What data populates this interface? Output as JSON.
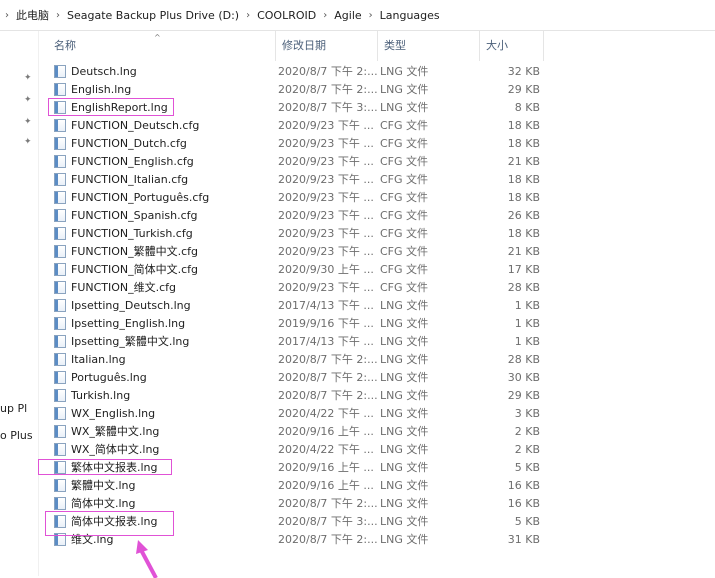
{
  "breadcrumb": {
    "items": [
      "此电脑",
      "Seagate Backup Plus Drive (D:)",
      "COOLROID",
      "Agile",
      "Languages"
    ]
  },
  "nav": {
    "partial_labels": [
      "up Pl",
      "o Plus"
    ]
  },
  "columns": {
    "name": "名称",
    "date": "修改日期",
    "type": "类型",
    "size": "大小"
  },
  "files": [
    {
      "name": "Deutsch.lng",
      "date": "2020/8/7 下午 2:...",
      "type": "LNG 文件",
      "size": "32 KB"
    },
    {
      "name": "English.lng",
      "date": "2020/8/7 下午 2:...",
      "type": "LNG 文件",
      "size": "29 KB"
    },
    {
      "name": "EnglishReport.lng",
      "date": "2020/8/7 下午 3:...",
      "type": "LNG 文件",
      "size": "8 KB"
    },
    {
      "name": "FUNCTION_Deutsch.cfg",
      "date": "2020/9/23 下午 ...",
      "type": "CFG 文件",
      "size": "18 KB"
    },
    {
      "name": "FUNCTION_Dutch.cfg",
      "date": "2020/9/23 下午 ...",
      "type": "CFG 文件",
      "size": "18 KB"
    },
    {
      "name": "FUNCTION_English.cfg",
      "date": "2020/9/23 下午 ...",
      "type": "CFG 文件",
      "size": "21 KB"
    },
    {
      "name": "FUNCTION_Italian.cfg",
      "date": "2020/9/23 下午 ...",
      "type": "CFG 文件",
      "size": "18 KB"
    },
    {
      "name": "FUNCTION_Português.cfg",
      "date": "2020/9/23 下午 ...",
      "type": "CFG 文件",
      "size": "18 KB"
    },
    {
      "name": "FUNCTION_Spanish.cfg",
      "date": "2020/9/23 下午 ...",
      "type": "CFG 文件",
      "size": "26 KB"
    },
    {
      "name": "FUNCTION_Turkish.cfg",
      "date": "2020/9/23 下午 ...",
      "type": "CFG 文件",
      "size": "18 KB"
    },
    {
      "name": "FUNCTION_繁體中文.cfg",
      "date": "2020/9/23 下午 ...",
      "type": "CFG 文件",
      "size": "21 KB"
    },
    {
      "name": "FUNCTION_简体中文.cfg",
      "date": "2020/9/30 上午 ...",
      "type": "CFG 文件",
      "size": "17 KB"
    },
    {
      "name": "FUNCTION_维文.cfg",
      "date": "2020/9/23 下午 ...",
      "type": "CFG 文件",
      "size": "28 KB"
    },
    {
      "name": "Ipsetting_Deutsch.lng",
      "date": "2017/4/13 下午 ...",
      "type": "LNG 文件",
      "size": "1 KB"
    },
    {
      "name": "Ipsetting_English.lng",
      "date": "2019/9/16 下午 ...",
      "type": "LNG 文件",
      "size": "1 KB"
    },
    {
      "name": "Ipsetting_繁體中文.lng",
      "date": "2017/4/13 下午 ...",
      "type": "LNG 文件",
      "size": "1 KB"
    },
    {
      "name": "Italian.lng",
      "date": "2020/8/7 下午 2:...",
      "type": "LNG 文件",
      "size": "28 KB"
    },
    {
      "name": "Português.lng",
      "date": "2020/8/7 下午 2:...",
      "type": "LNG 文件",
      "size": "30 KB"
    },
    {
      "name": "Turkish.lng",
      "date": "2020/8/7 下午 2:...",
      "type": "LNG 文件",
      "size": "29 KB"
    },
    {
      "name": "WX_English.lng",
      "date": "2020/4/22 下午 ...",
      "type": "LNG 文件",
      "size": "3 KB"
    },
    {
      "name": "WX_繁體中文.lng",
      "date": "2020/9/16 上午 ...",
      "type": "LNG 文件",
      "size": "2 KB"
    },
    {
      "name": "WX_简体中文.lng",
      "date": "2020/4/22 下午 ...",
      "type": "LNG 文件",
      "size": "2 KB"
    },
    {
      "name": "繁体中文报表.lng",
      "date": "2020/9/16 上午 ...",
      "type": "LNG 文件",
      "size": "5 KB"
    },
    {
      "name": "繁體中文.lng",
      "date": "2020/9/16 上午 ...",
      "type": "LNG 文件",
      "size": "16 KB"
    },
    {
      "name": "简体中文.lng",
      "date": "2020/8/7 下午 2:...",
      "type": "LNG 文件",
      "size": "16 KB"
    },
    {
      "name": "简体中文报表.lng",
      "date": "2020/8/7 下午 3:...",
      "type": "LNG 文件",
      "size": "5 KB"
    },
    {
      "name": "维文.lng",
      "date": "2020/8/7 下午 2:...",
      "type": "LNG 文件",
      "size": "31 KB"
    }
  ],
  "highlight_color": "#e052d6",
  "selected_files": [
    "EnglishReport.lng",
    "繁体中文报表.lng",
    "简体中文报表.lng"
  ]
}
